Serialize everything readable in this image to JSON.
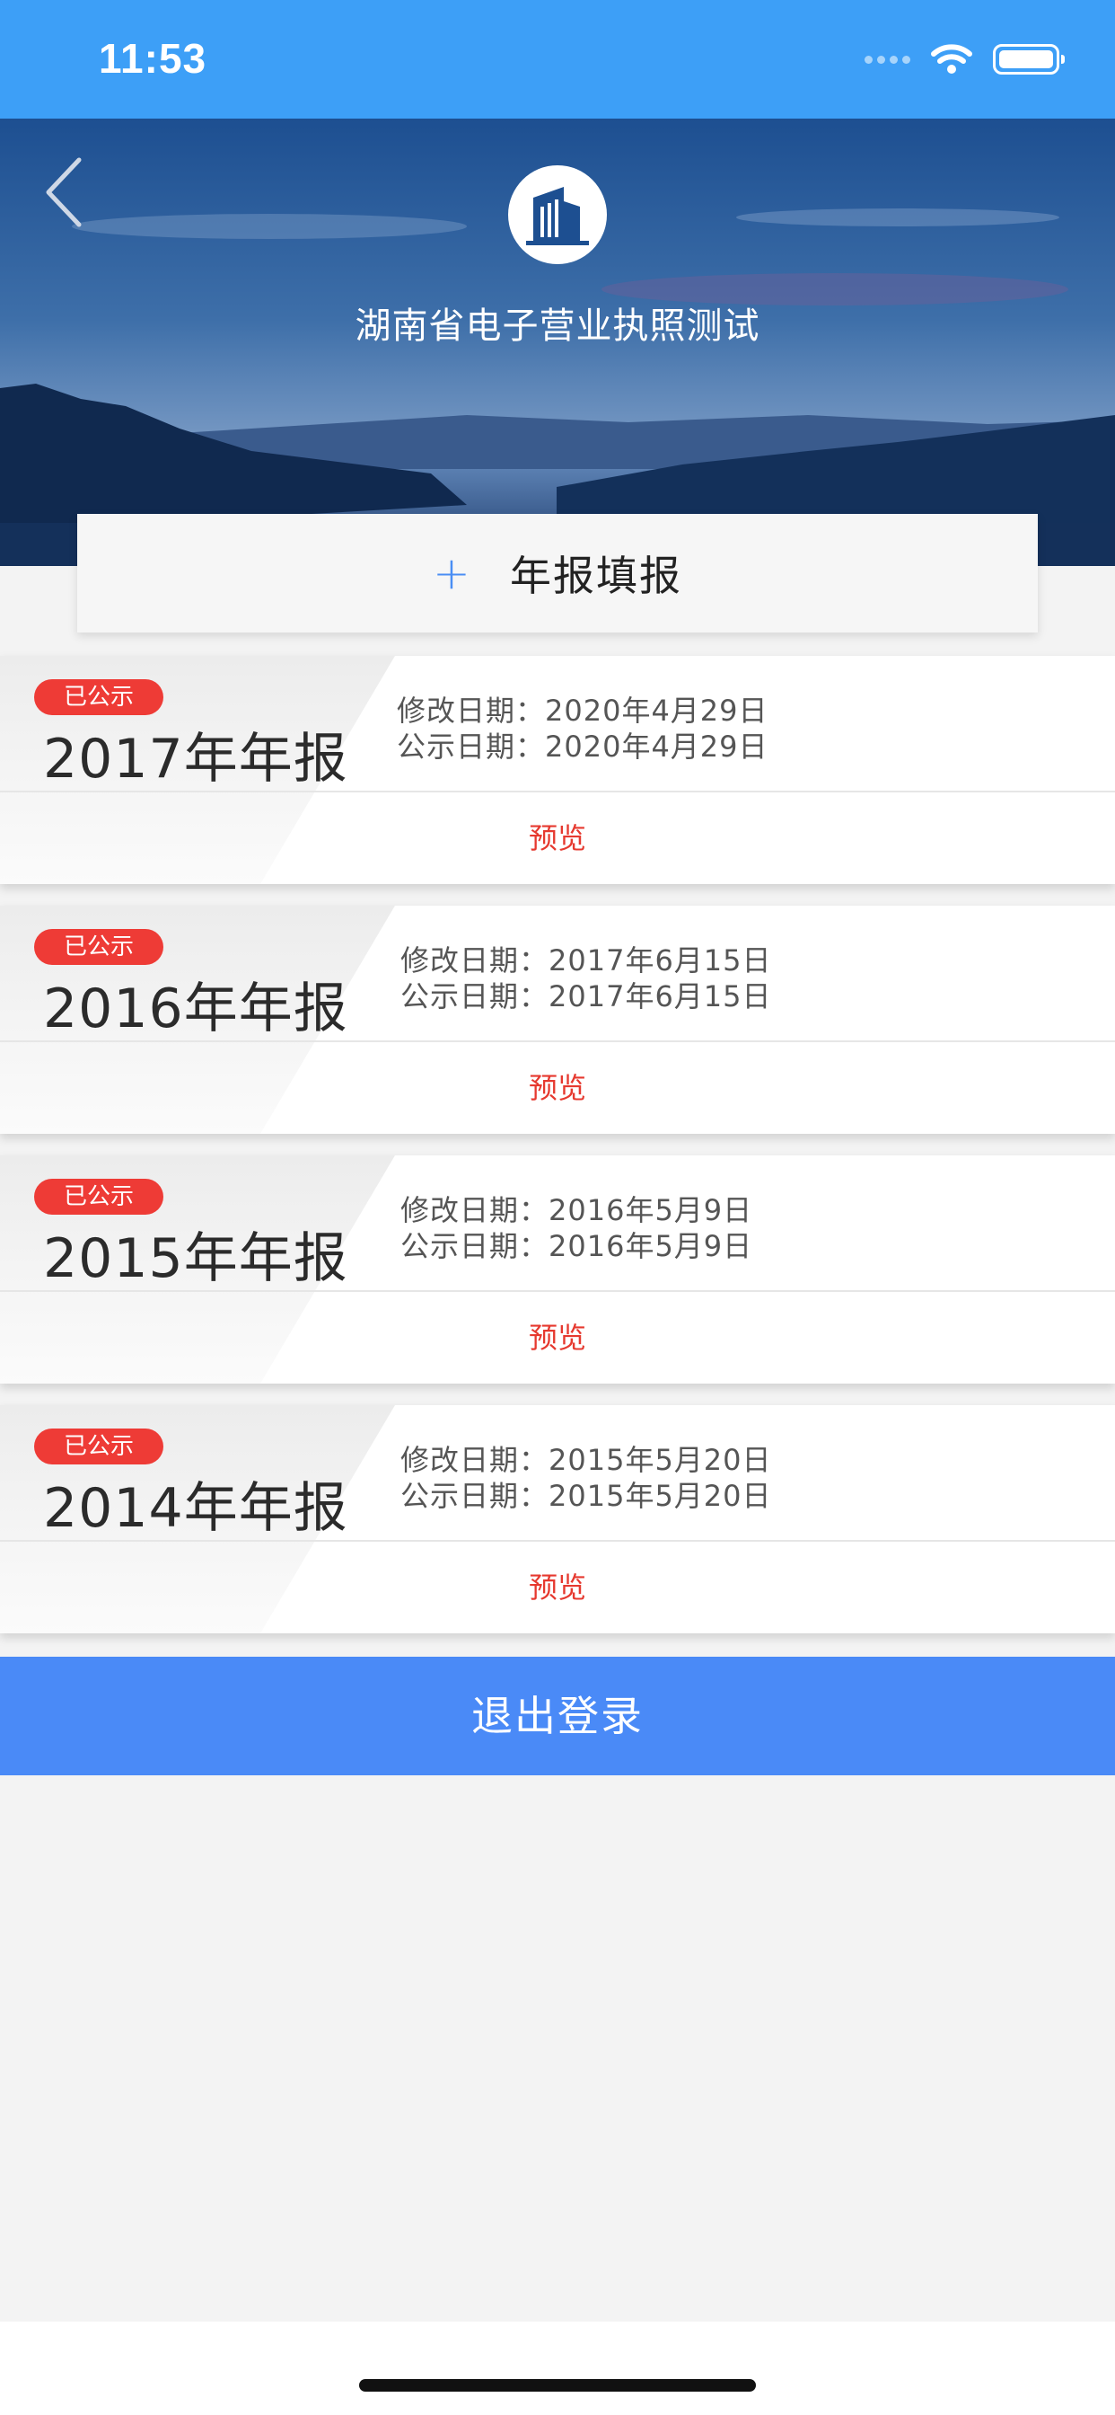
{
  "status_bar": {
    "time": "11:53"
  },
  "header": {
    "company_name": "湖南省电子营业执照测试"
  },
  "fill_button": {
    "label": "年报填报"
  },
  "reports": [
    {
      "badge": "已公示",
      "title": "2017年年报",
      "modified": "修改日期：2020年4月29日",
      "published": "公示日期：2020年4月29日",
      "action": "预览"
    },
    {
      "badge": "已公示",
      "title": "2016年年报",
      "modified": "修改日期：2017年6月15日",
      "published": "公示日期：2017年6月15日",
      "action": "预览"
    },
    {
      "badge": "已公示",
      "title": "2015年年报",
      "modified": "修改日期：2016年5月9日",
      "published": "公示日期：2016年5月9日",
      "action": "预览"
    },
    {
      "badge": "已公示",
      "title": "2014年年报",
      "modified": "修改日期：2015年5月20日",
      "published": "公示日期：2015年5月20日",
      "action": "预览"
    }
  ],
  "logout": {
    "label": "退出登录"
  },
  "icons": {
    "back": "chevron-left-icon",
    "logo": "building-icon",
    "fill": "plus-icon",
    "wifi": "wifi-icon",
    "battery": "battery-icon",
    "signal": "signal-icon"
  },
  "colors": {
    "status_bar": "#3d9ff7",
    "badge": "#ee3b36",
    "preview": "#e6392f",
    "logout": "#4a8af7",
    "accent": "#4a8ef4"
  }
}
